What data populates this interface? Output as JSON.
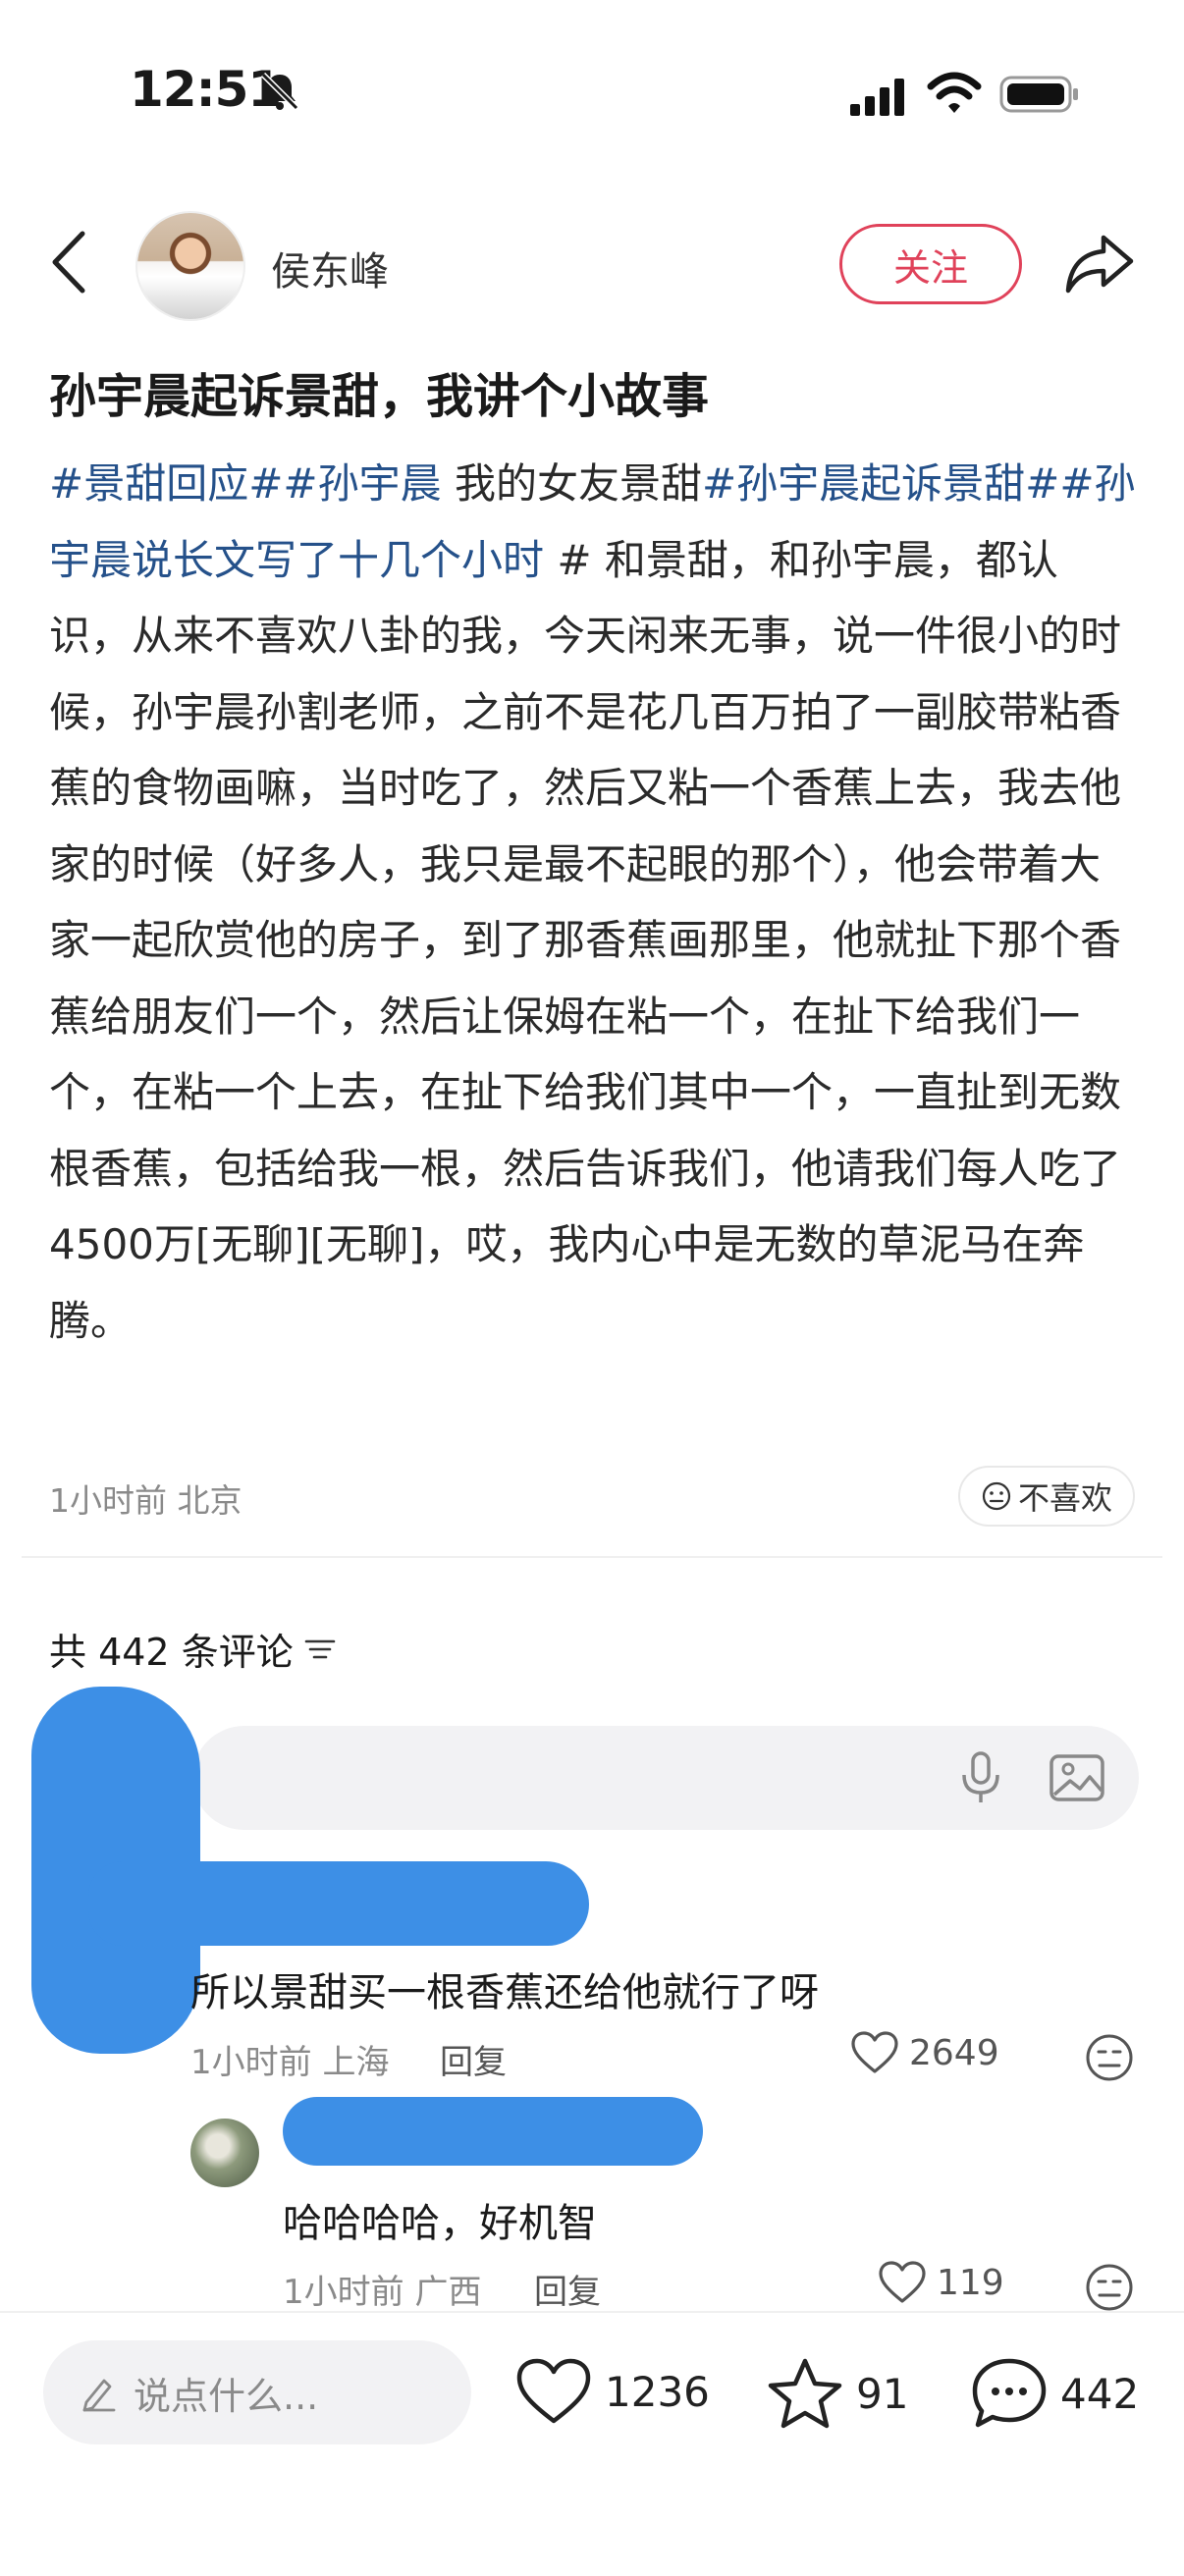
{
  "status_bar": {
    "time": "12:51"
  },
  "header": {
    "author": "侯东峰",
    "follow_label": "关注"
  },
  "post": {
    "title": "孙宇晨起诉景甜，我讲个小故事",
    "tags": [
      "#景甜回应#",
      "#孙宇晨",
      "#孙宇晨起诉景甜#",
      "#孙宇晨说长文写了十几个小时"
    ],
    "mid_text": " 我的女友景甜",
    "tag_end": " #",
    "body": " 和景甜，和孙宇晨，都认识，从来不喜欢八卦的我，今天闲来无事，说一件很小的时候，孙宇晨孙割老师，之前不是花几百万拍了一副胶带粘香蕉的食物画嘛，当时吃了，然后又粘一个香蕉上去，我去他家的时候（好多人，我只是最不起眼的那个），他会带着大家一起欣赏他的房子，到了那香蕉画那里，他就扯下那个香蕉给朋友们一个，然后让保姆在粘一个，在扯下给我们一个，在粘一个上去，在扯下给我们其中一个，一直扯到无数根香蕉，包括给我一根，然后告诉我们，他请我们每人吃了4500万[无聊][无聊]，哎，我内心中是无数的草泥马在奔腾。",
    "meta": "1小时前 北京",
    "dislike_label": "不喜欢"
  },
  "comments": {
    "count_label": "共 442 条评论",
    "list": [
      {
        "text": "所以景甜买一根香蕉还给他就行了呀",
        "meta": "1小时前 上海",
        "reply_label": "回复",
        "likes": "2649",
        "replies": [
          {
            "text": "哈哈哈哈，好机智",
            "meta": "1小时前 广西",
            "reply_label": "回复",
            "likes": "119"
          }
        ]
      }
    ]
  },
  "bottom_bar": {
    "placeholder": "说点什么...",
    "likes": "1236",
    "favorites": "91",
    "comments": "442"
  }
}
